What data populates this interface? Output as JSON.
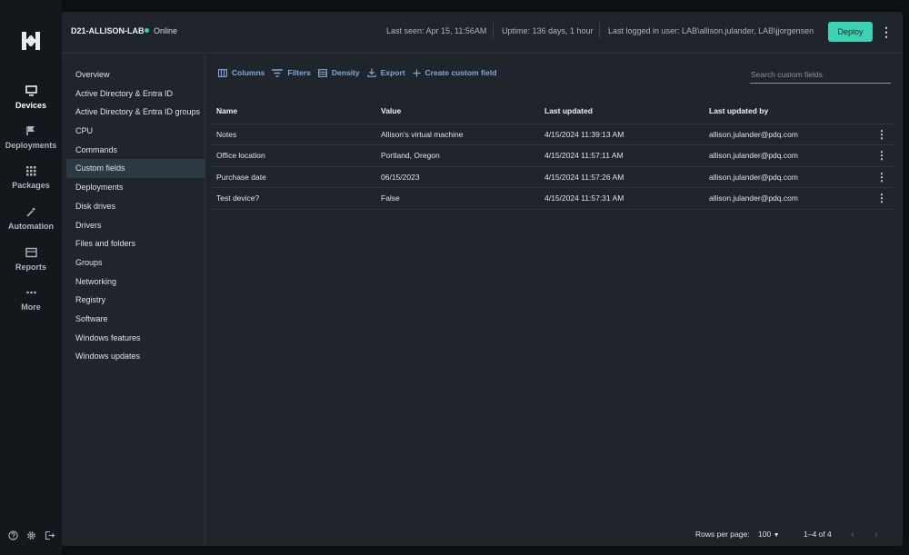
{
  "rail": {
    "items": [
      {
        "label": "Devices",
        "icon": "monitor-icon"
      },
      {
        "label": "Deployments",
        "icon": "flag-icon"
      },
      {
        "label": "Packages",
        "icon": "grid-icon"
      },
      {
        "label": "Automation",
        "icon": "wand-icon"
      },
      {
        "label": "Reports",
        "icon": "report-icon"
      },
      {
        "label": "More",
        "icon": "more-dots-icon"
      }
    ],
    "active": "Devices"
  },
  "header": {
    "device_name": "D21-ALLISON-LAB",
    "status": "Online",
    "last_seen": "Last seen: Apr 15, 11:56AM",
    "uptime": "Uptime: 136 days, 1 hour",
    "last_user": "Last logged in user: LAB\\allison.julander, LAB\\jjorgensen",
    "deploy_label": "Deploy"
  },
  "subnav": {
    "items": [
      "Overview",
      "Active Directory & Entra ID",
      "Active Directory & Entra ID groups",
      "CPU",
      "Commands",
      "Custom fields",
      "Deployments",
      "Disk drives",
      "Drivers",
      "Files and folders",
      "Groups",
      "Networking",
      "Registry",
      "Software",
      "Windows features",
      "Windows updates"
    ],
    "active": "Custom fields"
  },
  "toolbar": {
    "columns": "Columns",
    "filters": "Filters",
    "density": "Density",
    "export": "Export",
    "create": "Create custom field",
    "search_placeholder": "Search custom fields"
  },
  "table": {
    "headers": [
      "Name",
      "Value",
      "Last updated",
      "Last updated by"
    ],
    "rows": [
      [
        "Notes",
        "Allison's virtual machine",
        "4/15/2024 11:39:13 AM",
        "allison.julander@pdq.com"
      ],
      [
        "Office location",
        "Portland, Oregon",
        "4/15/2024 11:57:11 AM",
        "allison.julander@pdq.com"
      ],
      [
        "Purchase date",
        "06/15/2023",
        "4/15/2024 11:57:26 AM",
        "allison.julander@pdq.com"
      ],
      [
        "Test device?",
        "False",
        "4/15/2024 11:57:31 AM",
        "allison.julander@pdq.com"
      ]
    ]
  },
  "pager": {
    "rows_per_page_label": "Rows per page:",
    "rows_per_page": "100",
    "range": "1–4 of 4"
  },
  "colors": {
    "accent": "#3fd1b4",
    "link": "#7fa9dd",
    "online": "#3dcbb1",
    "selected_row": "#2c3a43"
  }
}
